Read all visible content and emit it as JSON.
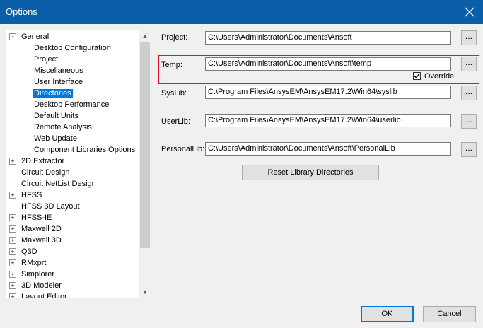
{
  "window": {
    "title": "Options"
  },
  "tree": {
    "items": [
      {
        "label": "General",
        "expander": "−",
        "level": 0
      },
      {
        "label": "Desktop Configuration",
        "level": 1
      },
      {
        "label": "Project",
        "level": 1
      },
      {
        "label": "Miscellaneous",
        "level": 1
      },
      {
        "label": "User Interface",
        "level": 1
      },
      {
        "label": "Directories",
        "level": 1,
        "selected": true
      },
      {
        "label": "Desktop Performance",
        "level": 1
      },
      {
        "label": "Default Units",
        "level": 1
      },
      {
        "label": "Remote Analysis",
        "level": 1
      },
      {
        "label": "Web Update",
        "level": 1
      },
      {
        "label": "Component Libraries Options",
        "level": 1
      },
      {
        "label": "2D Extractor",
        "expander": "+",
        "level": 0
      },
      {
        "label": "Circuit Design",
        "level": 0
      },
      {
        "label": "Circuit NetList Design",
        "level": 0
      },
      {
        "label": "HFSS",
        "expander": "+",
        "level": 0
      },
      {
        "label": "HFSS 3D Layout",
        "level": 0
      },
      {
        "label": "HFSS-IE",
        "expander": "+",
        "level": 0
      },
      {
        "label": "Maxwell 2D",
        "expander": "+",
        "level": 0
      },
      {
        "label": "Maxwell 3D",
        "expander": "+",
        "level": 0
      },
      {
        "label": "Q3D",
        "expander": "+",
        "level": 0
      },
      {
        "label": "RMxprt",
        "expander": "+",
        "level": 0
      },
      {
        "label": "Simplorer",
        "expander": "+",
        "level": 0
      },
      {
        "label": "3D Modeler",
        "expander": "+",
        "level": 0
      },
      {
        "label": "Layout Editor",
        "expander": "+",
        "level": 0
      }
    ]
  },
  "directories": {
    "project": {
      "label": "Project:",
      "value": "C:\\Users\\Administrator\\Documents\\Ansoft",
      "browse": "..."
    },
    "temp": {
      "label": "Temp:",
      "value": "C:\\Users\\Administrator\\Documents\\Ansoft\\temp",
      "browse": "...",
      "override_label": "Override",
      "override_checked": true
    },
    "syslib": {
      "label": "SysLib:",
      "value": "C:\\Program Files\\AnsysEM\\AnsysEM17.2\\Win64\\syslib",
      "browse": "..."
    },
    "userlib": {
      "label": "UserLib:",
      "value": "C:\\Program Files\\AnsysEM\\AnsysEM17.2\\Win64\\userlib",
      "browse": "..."
    },
    "personallib": {
      "label": "PersonalLib:",
      "value": "C:\\Users\\Administrator\\Documents\\Ansoft\\PersonalLib",
      "browse": "..."
    },
    "reset_label": "Reset Library Directories"
  },
  "footer": {
    "ok_label": "OK",
    "cancel_label": "Cancel"
  },
  "colors": {
    "titlebar": "#0b5ea8",
    "selection": "#0078d7",
    "highlight_border": "#e81123"
  }
}
